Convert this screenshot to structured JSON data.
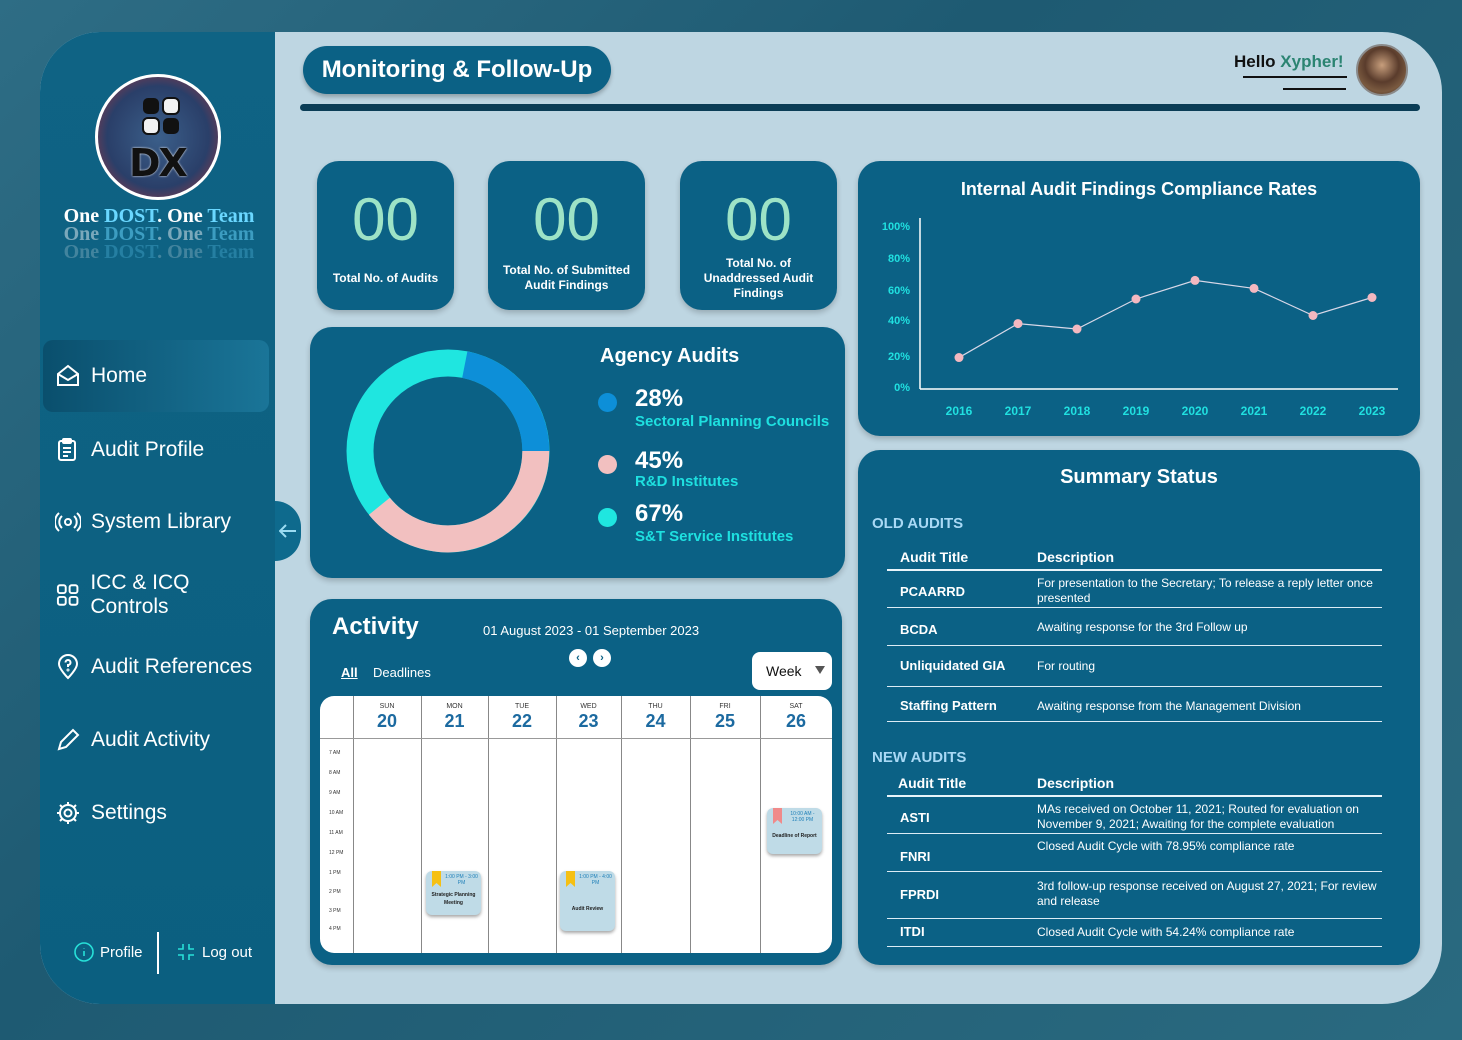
{
  "sidebar": {
    "slogan": {
      "w1": "One ",
      "w2": "DOST",
      "w3": ". One ",
      "w4": "Team"
    },
    "items": [
      {
        "label": "Home",
        "icon": "home-icon",
        "active": true
      },
      {
        "label": "Audit Profile",
        "icon": "clipboard-icon"
      },
      {
        "label": "System Library",
        "icon": "broadcast-icon"
      },
      {
        "label": "ICC & ICQ Controls",
        "icon": "grid-icon"
      },
      {
        "label": "Audit References",
        "icon": "location-help-icon"
      },
      {
        "label": "Audit Activity",
        "icon": "pencil-icon"
      },
      {
        "label": "Settings",
        "icon": "gear-icon"
      }
    ],
    "profile_label": "Profile",
    "logout_label": "Log out"
  },
  "header": {
    "title": "Monitoring & Follow-Up",
    "hello": "Hello ",
    "user": "Xypher!"
  },
  "stats": [
    {
      "value": "00",
      "label": "Total No. of Audits"
    },
    {
      "value": "00",
      "label": "Total No. of Submitted Audit Findings"
    },
    {
      "value": "00",
      "label": "Total No. of Unaddressed Audit Findings"
    }
  ],
  "agency": {
    "title": "Agency Audits",
    "items": [
      {
        "pct": "28%",
        "label": "Sectoral Planning Councils",
        "color": "#0d8fd8"
      },
      {
        "pct": "45%",
        "label": "R&D Institutes",
        "color": "#f2c0c0"
      },
      {
        "pct": "67%",
        "label": "S&T Service Institutes",
        "color": "#1fe6e0"
      }
    ]
  },
  "chart_data": {
    "type": "line",
    "title": "Internal Audit Findings Compliance Rates",
    "x": [
      "2016",
      "2017",
      "2018",
      "2019",
      "2020",
      "2021",
      "2022",
      "2023"
    ],
    "y_ticks": [
      "100%",
      "80%",
      "60%",
      "40%",
      "20%",
      "0%"
    ],
    "values": [
      19,
      38,
      35,
      54,
      66,
      61,
      43,
      55
    ],
    "ylim": [
      0,
      100
    ],
    "colors": {
      "line": "#d8d8e8",
      "point": "#f4b8c0",
      "tick_x": "#20e0e0"
    }
  },
  "summary": {
    "title": "Summary Status",
    "old_label": "OLD AUDITS",
    "new_label": "NEW AUDITS",
    "col_title": "Audit Title",
    "col_desc": "Description",
    "old": [
      {
        "title": "PCAARRD",
        "desc": "For presentation to the Secretary; To release a reply letter once presented"
      },
      {
        "title": "BCDA",
        "desc": "Awaiting response for the 3rd Follow up"
      },
      {
        "title": "Unliquidated GIA",
        "desc": "For routing"
      },
      {
        "title": "Staffing Pattern",
        "desc": "Awaiting response from the Management Division"
      }
    ],
    "new": [
      {
        "title": "ASTI",
        "desc": "MAs received on October 11, 2021; Routed for evaluation on November 9, 2021; Awaiting for the complete evaluation"
      },
      {
        "title": "FNRI",
        "desc": "Closed Audit Cycle with 78.95% compliance rate"
      },
      {
        "title": "FPRDI",
        "desc": "3rd follow-up response received on August 27, 2021; For review and release"
      },
      {
        "title": "ITDI",
        "desc": "Closed Audit Cycle with 54.24% compliance rate"
      }
    ]
  },
  "activity": {
    "title": "Activity",
    "range": "01 August 2023 - 01 September 2023",
    "tab_all": "All",
    "tab_deadlines": "Deadlines",
    "view": "Week",
    "days": [
      {
        "name": "SUN",
        "date": "20"
      },
      {
        "name": "MON",
        "date": "21"
      },
      {
        "name": "TUE",
        "date": "22"
      },
      {
        "name": "WED",
        "date": "23"
      },
      {
        "name": "THU",
        "date": "24"
      },
      {
        "name": "FRI",
        "date": "25"
      },
      {
        "name": "SAT",
        "date": "26"
      }
    ],
    "times": [
      "7 AM",
      "8 AM",
      "9 AM",
      "10 AM",
      "11 AM",
      "12 PM",
      "1 PM",
      "2 PM",
      "3 PM",
      "4 PM"
    ],
    "events": [
      {
        "time": "1:00 PM - 3:00 PM",
        "name": "Strategic Planning Meeting",
        "flag": "#f5c013"
      },
      {
        "time": "1:00 PM - 4:00 PM",
        "name": "Audit Review",
        "flag": "#f5c013"
      },
      {
        "time": "10:00 AM - 12:00 PM",
        "name": "Deadline of Report",
        "flag": "#f08a8a"
      }
    ]
  }
}
